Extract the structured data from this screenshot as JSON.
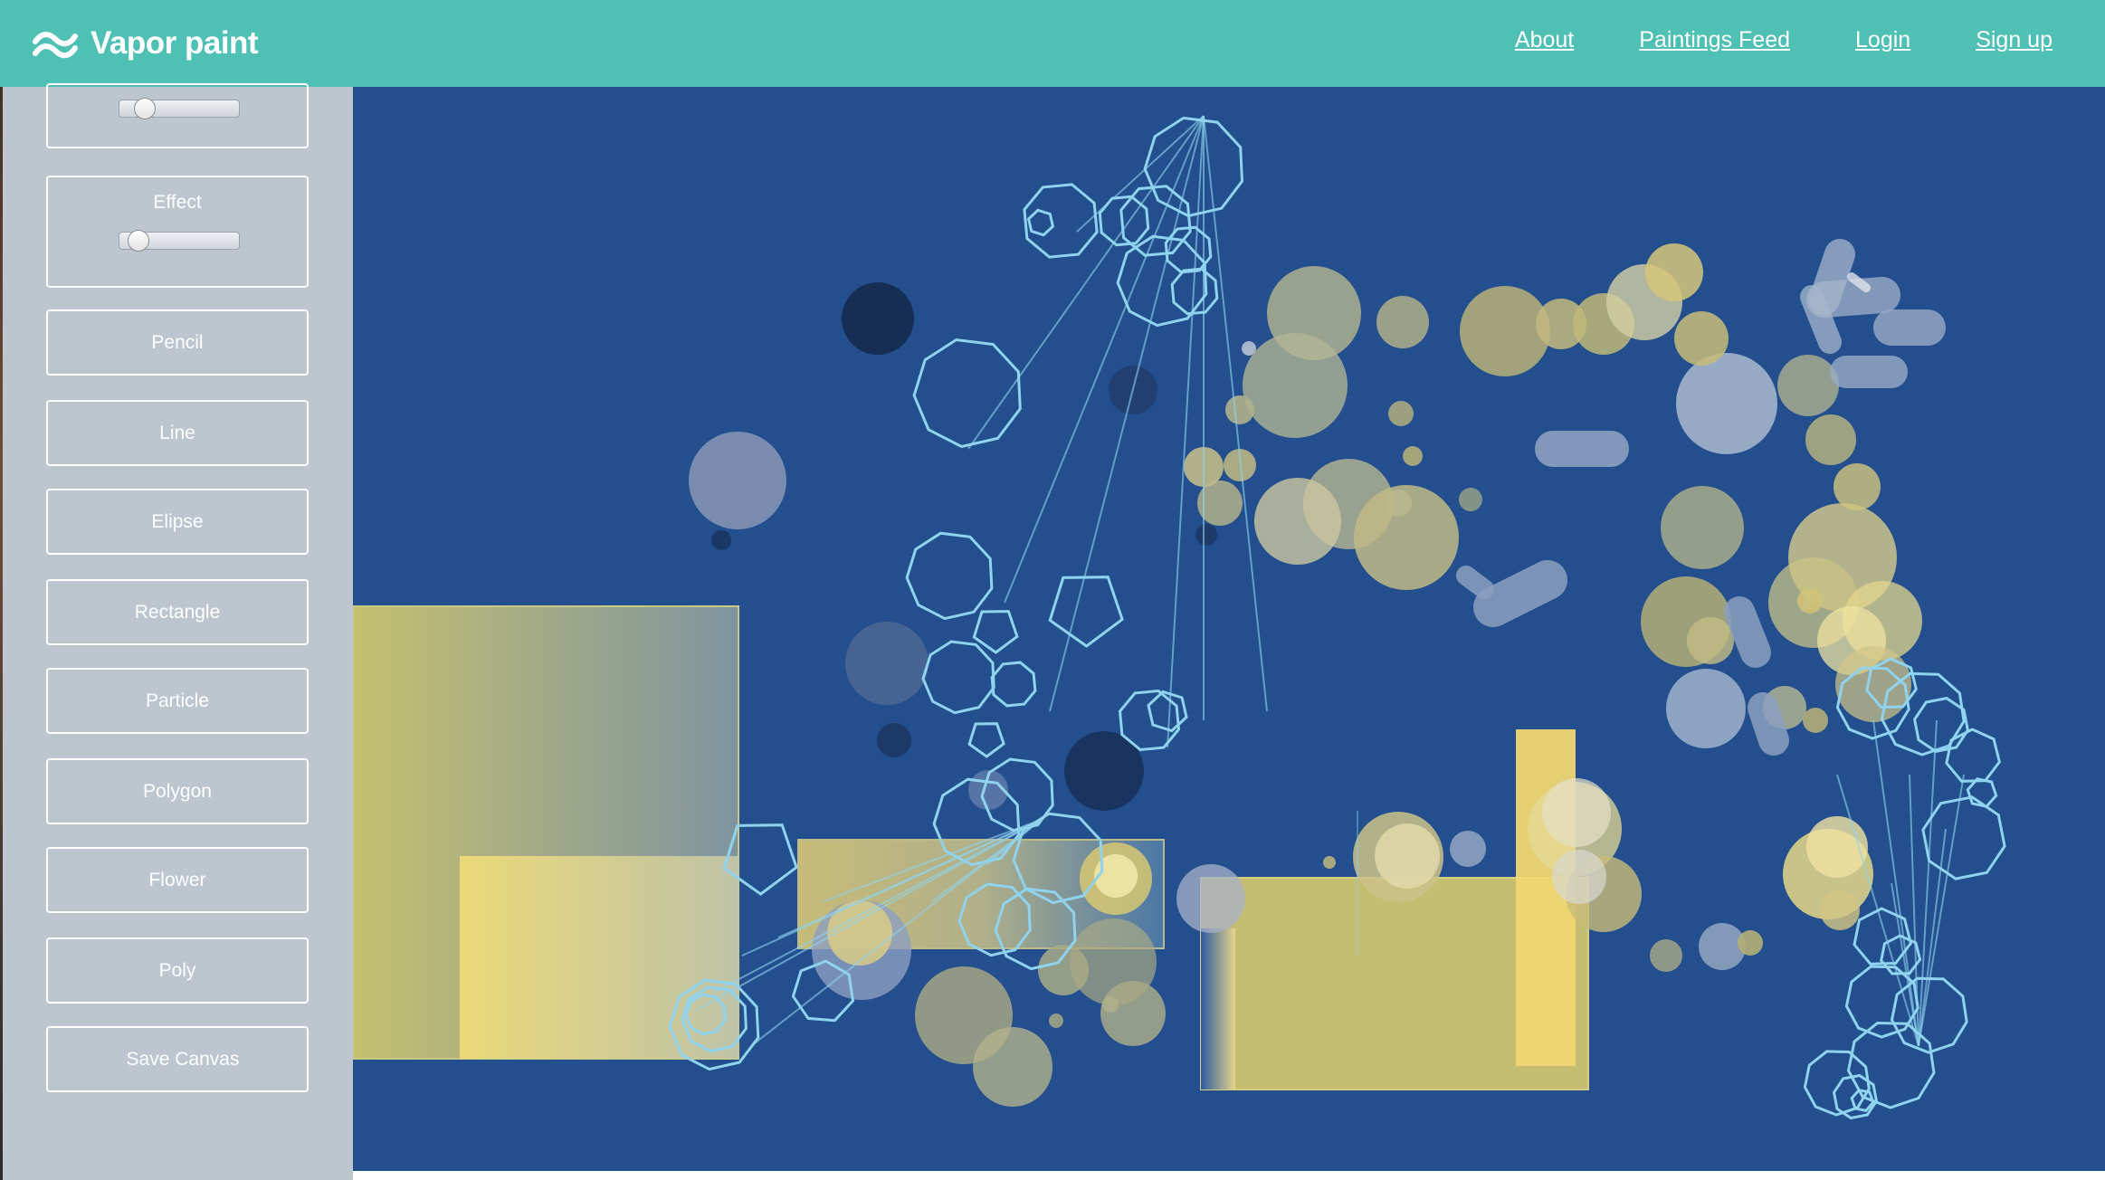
{
  "app": {
    "name": "Vapor paint",
    "logo_icon": "waves-icon",
    "brand_color": "#4fc0b4",
    "canvas_color": "#234f8e"
  },
  "nav": {
    "links": [
      "About",
      "Paintings Feed",
      "Login",
      "Sign up"
    ]
  },
  "sidebar": {
    "effect_label": "Effect",
    "top_slider_value": 0.12,
    "effect_slider_value": 0.05,
    "tools": [
      "Pencil",
      "Line",
      "Elipse",
      "Rectangle",
      "Particle",
      "Polygon",
      "Flower",
      "Poly",
      "Save Canvas"
    ]
  }
}
